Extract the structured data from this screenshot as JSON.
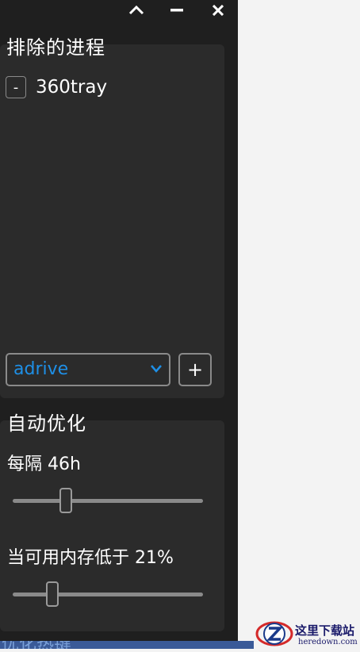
{
  "window": {
    "buttons": [
      "chevron-up",
      "minimize",
      "close"
    ]
  },
  "excluded": {
    "title": "排除的进程",
    "items": [
      {
        "remove_label": "-",
        "name": "360tray"
      }
    ],
    "dropdown_value": "adrive",
    "add_label": "+"
  },
  "auto": {
    "title": "自动优化",
    "interval_label": "每隔 46h",
    "interval_value": 46,
    "interval_fraction": 0.28,
    "memory_label": "当可用内存低于 21%",
    "memory_value": 21,
    "memory_fraction": 0.21
  },
  "footer": {
    "partial_text": "优化热键"
  },
  "watermark": {
    "title": "这里下载站",
    "site": "heredown.com"
  },
  "colors": {
    "panel": "#1f1f1f",
    "card": "#2b2b2b",
    "accent": "#1e8fe6",
    "border": "#8a8a8a"
  }
}
